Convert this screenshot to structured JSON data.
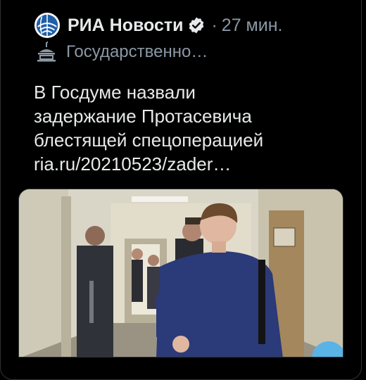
{
  "tweet": {
    "author": "РИА Новости",
    "separator": "·",
    "time": "27 мин.",
    "account_label": "Государственно…",
    "text_lines": [
      "В Госдуме назвали",
      "задержание Протасевича",
      "блестящей спецоперацией",
      "ria.ru/20210523/zader…"
    ],
    "icons": {
      "avatar": "ria-globe-logo",
      "verified": "verified-badge-icon",
      "government": "government-building-icon"
    }
  },
  "colors": {
    "background": "#000000",
    "text_primary": "#e7e9ea",
    "text_secondary": "#8b98a5",
    "ria_blue": "#1f5fa8",
    "border": "#2f3336"
  }
}
